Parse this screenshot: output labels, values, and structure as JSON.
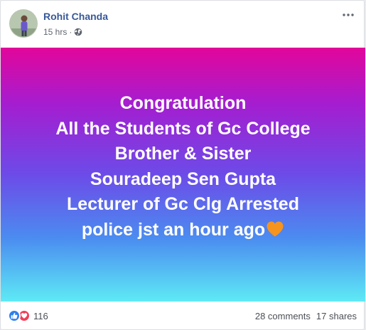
{
  "post": {
    "author": "Rohit Chanda",
    "time": "15 hrs",
    "separator": "·",
    "privacy_icon": "globe-icon",
    "more_icon": "more-horizontal-icon"
  },
  "banner": {
    "lines": [
      "Congratulation",
      "All the Students of Gc College",
      "Brother & Sister",
      "Souradeep Sen Gupta",
      "Lecturer of Gc Clg Arrested",
      "police jst an hour ago"
    ],
    "emoji": "orange-heart-emoji",
    "gradient_colors": [
      "#e2069a",
      "#a51dd0",
      "#6c4be8",
      "#4b8cf0",
      "#5eeaf5"
    ]
  },
  "footer": {
    "reaction_icons": [
      "like-icon",
      "love-icon"
    ],
    "reaction_count": "116",
    "comments": "28 comments",
    "shares": "17 shares"
  },
  "colors": {
    "author_link": "#385898",
    "like_blue": "#2f80ed",
    "love_red": "#f33e58",
    "heart_orange": "#f7941d"
  }
}
